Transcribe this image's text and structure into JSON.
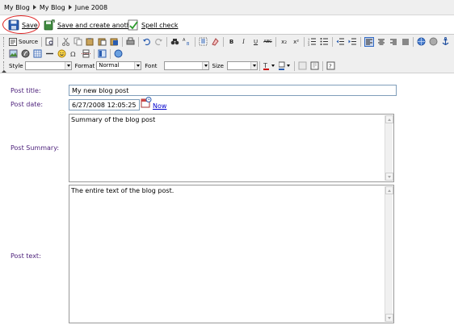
{
  "breadcrumb": [
    "My Blog",
    "My Blog",
    "June 2008"
  ],
  "actions": {
    "save": "Save",
    "save_and_create": "Save and create another",
    "spell_check": "Spell check"
  },
  "editor": {
    "source_label": "Source",
    "style_label": "Style",
    "format_label": "Format",
    "format_value": "Normal",
    "font_label": "Font",
    "size_label": "Size",
    "bold": "B",
    "italic": "I",
    "underline": "U",
    "strike": "ABC",
    "subscript": "x₂",
    "superscript": "x²"
  },
  "form": {
    "title_label": "Post title:",
    "title_value": "My new blog post",
    "date_label": "Post date:",
    "date_value": "6/27/2008 12:05:25",
    "now_label": "Now",
    "summary_label": "Post Summary:",
    "summary_value": "Summary of the blog post",
    "text_label": "Post text:",
    "text_value": "The entire text of the blog post."
  },
  "colors": {
    "label_purple": "#4b1f7a",
    "highlight_red": "#dd2222",
    "link_blue": "#0000cc"
  }
}
